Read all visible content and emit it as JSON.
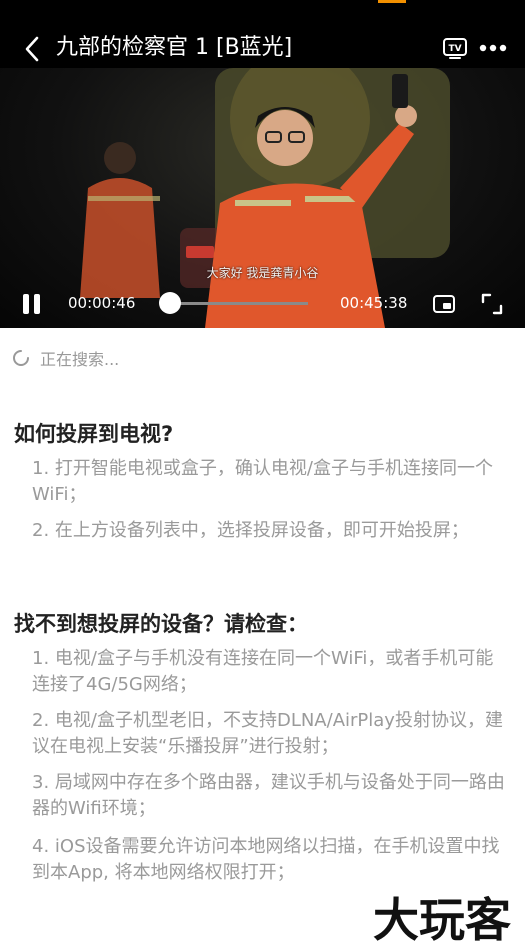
{
  "player": {
    "title": "九部的检察官 1 [B蓝光]",
    "subtitle": "大家好 我是龚青小谷",
    "current_time": "00:00:46",
    "total_time": "00:45:38",
    "progress_fraction": 0.017,
    "icons": [
      "back-icon",
      "tv-cast-icon",
      "more-icon",
      "pause-icon",
      "pip-icon",
      "fullscreen-icon"
    ],
    "accent_color": "#f29000"
  },
  "search": {
    "status": "正在搜索..."
  },
  "howto": {
    "title": "如何投屏到电视?",
    "items": [
      "1. 打开智能电视或盒子，确认电视/盒子与手机连接同一个WiFi；",
      "2. 在上方设备列表中，选择投屏设备，即可开始投屏；"
    ]
  },
  "troubleshoot": {
    "title": "找不到想投屏的设备？请检查：",
    "items": [
      "1. 电视/盒子与手机没有连接在同一个WiFi，或者手机可能连接了4G/5G网络；",
      "2. 电视/盒子机型老旧，不支持DLNA/AirPlay投射协议，建议在电视上安装“乐播投屏”进行投射；",
      "3. 局域网中存在多个路由器，建议手机与设备处于同一路由器的Wifi环境；",
      "4. iOS设备需要允许访问本地网络以扫描，在手机设置中找到本App, 将本地网络权限打开；"
    ]
  },
  "watermark": {
    "text": "大玩客"
  }
}
